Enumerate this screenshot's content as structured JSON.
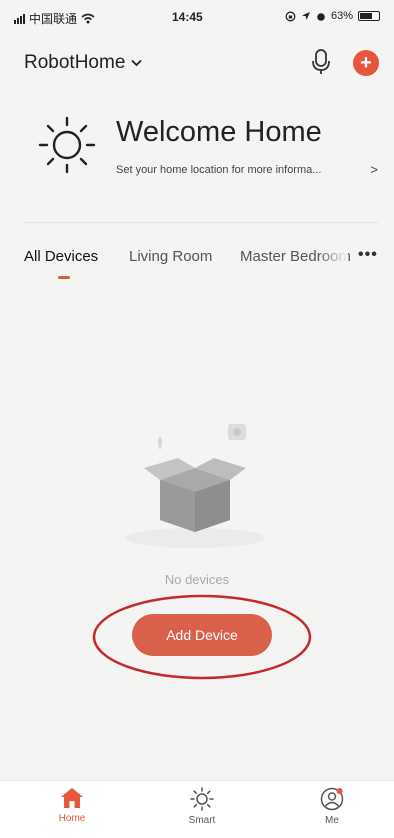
{
  "status_bar": {
    "carrier": "中国联通",
    "time": "14:45",
    "battery": "63%"
  },
  "header": {
    "home_name": "RobotHome",
    "add_icon_glyph": "+"
  },
  "welcome": {
    "title": "Welcome Home",
    "subtitle": "Set your home location for more informa...",
    "arrow": ">"
  },
  "tabs": [
    {
      "label": "All Devices",
      "active": true
    },
    {
      "label": "Living Room",
      "active": false
    },
    {
      "label": "Master Bedroom",
      "active": false
    }
  ],
  "tabs_more": "•••",
  "empty_state": {
    "message": "No devices",
    "button_label": "Add Device"
  },
  "bottom_nav": [
    {
      "label": "Home",
      "icon": "house-icon",
      "active": true
    },
    {
      "label": "Smart",
      "icon": "sun-icon",
      "active": false
    },
    {
      "label": "Me",
      "icon": "profile-icon",
      "active": false
    }
  ],
  "colors": {
    "accent": "#e5563c",
    "button": "#d9614b",
    "annotation_ring": "#c42a2a"
  }
}
